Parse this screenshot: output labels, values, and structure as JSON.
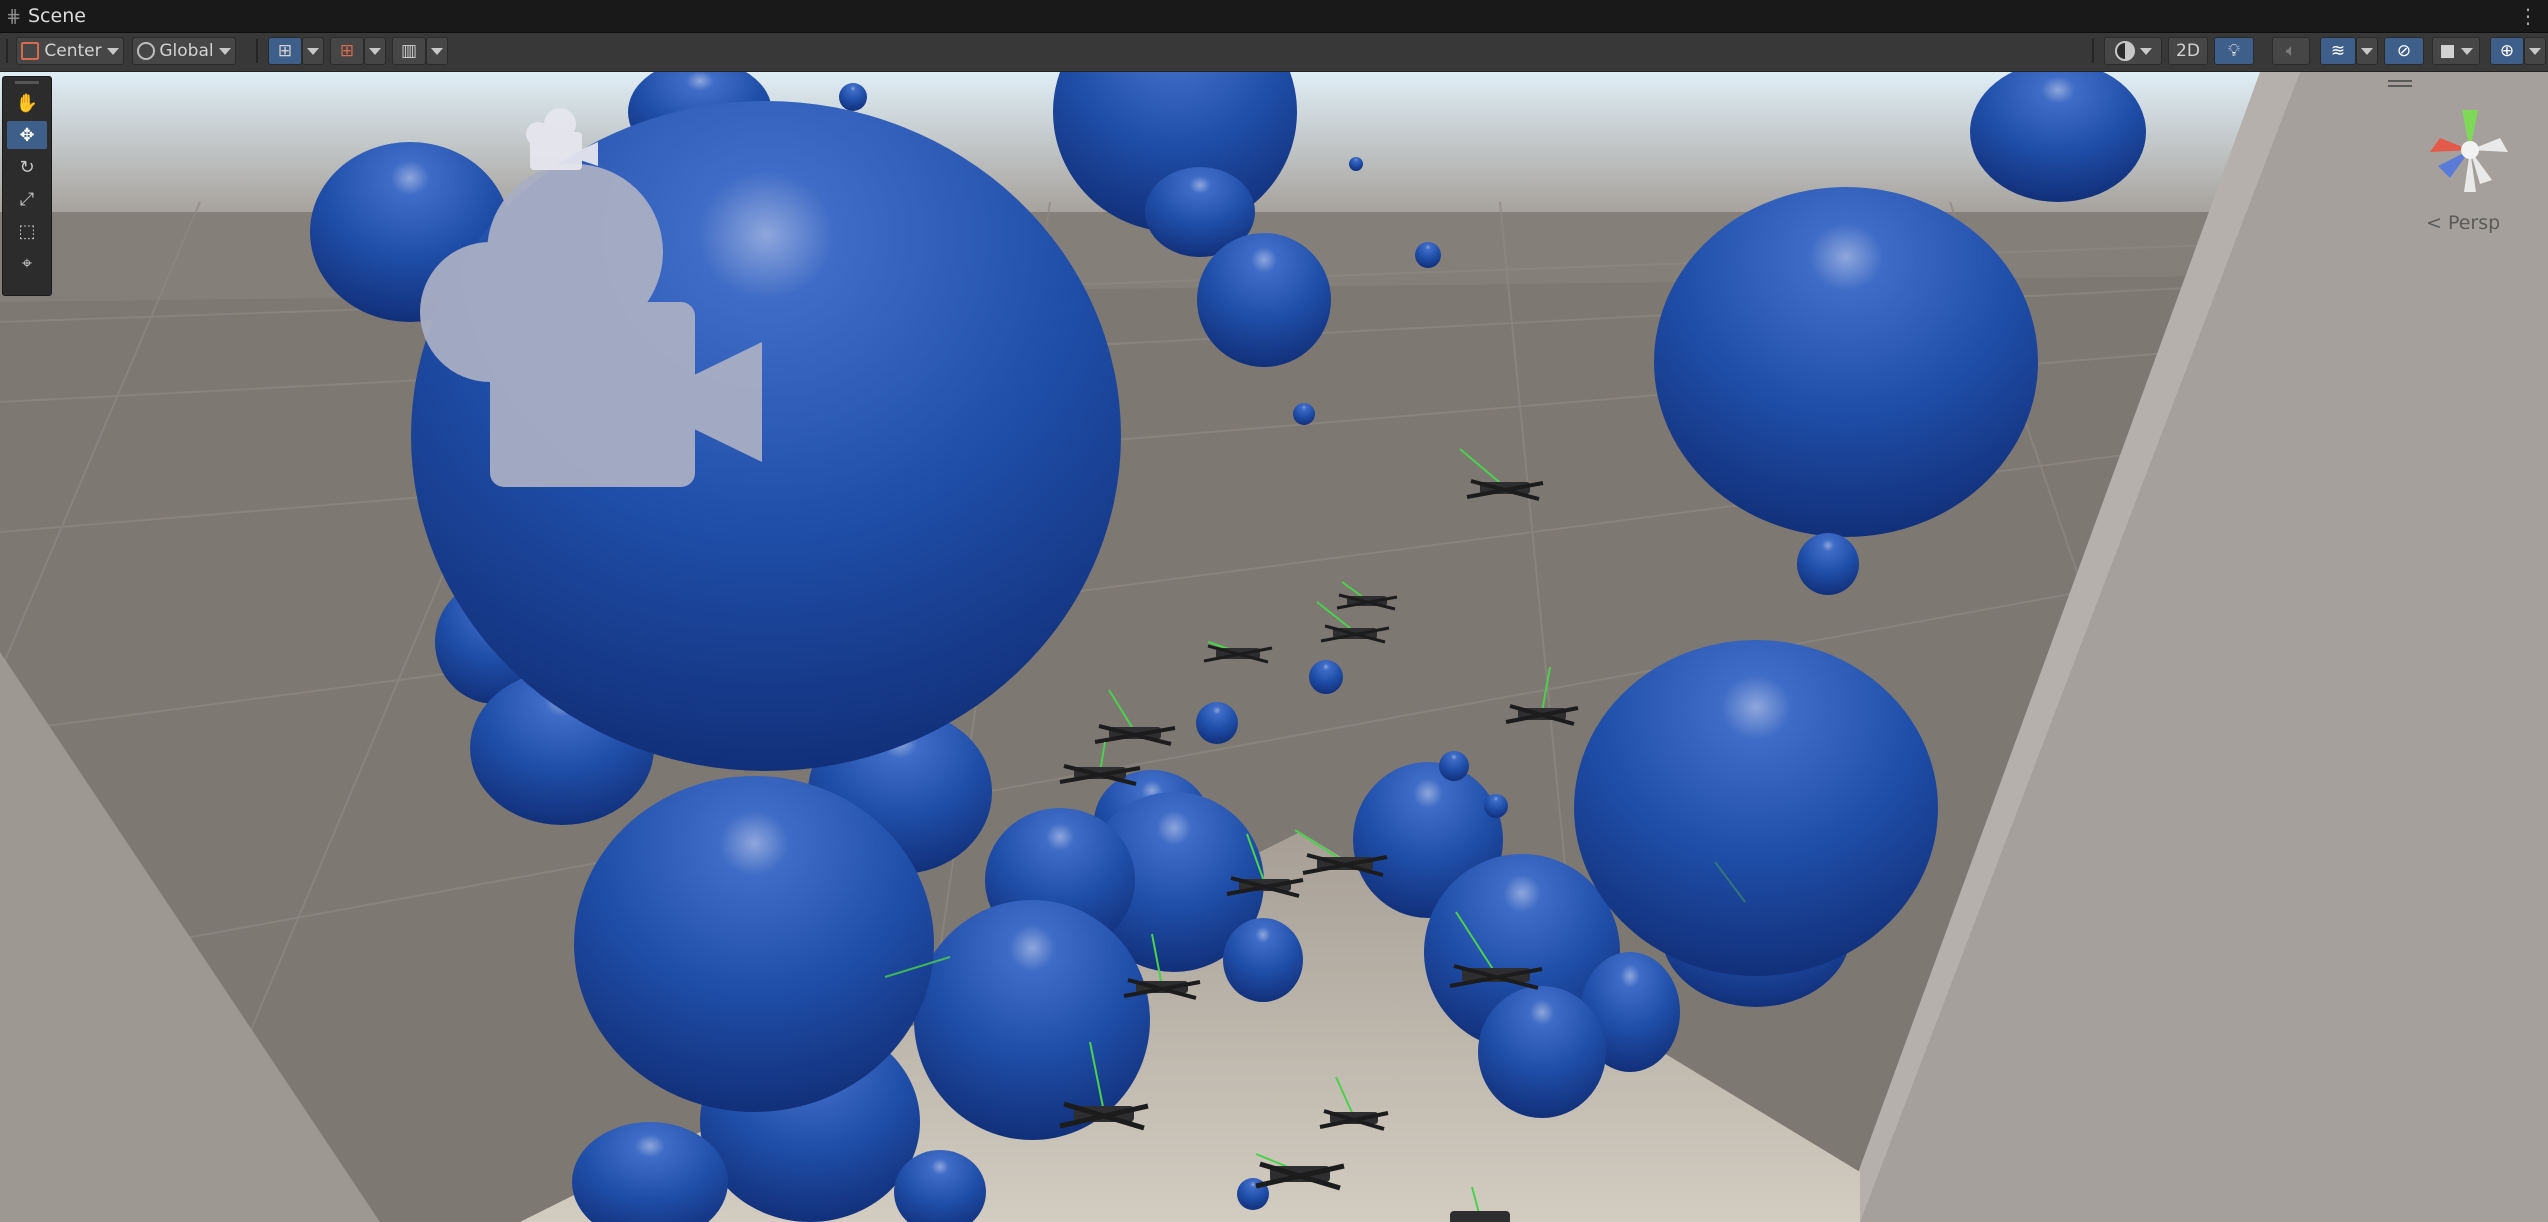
{
  "window": {
    "tab_title": "Scene",
    "menu_icon": "kebab-menu-icon"
  },
  "toolbar": {
    "pivot_mode": "Center",
    "pivot_rotation": "Global",
    "grid_snap_icon": "grid-snap-icon",
    "increment_snap_icon": "increment-snap-icon",
    "ruler_icon": "ruler-icon",
    "draw_mode_icon": "shading-sphere-icon",
    "mode_2d": "2D",
    "lighting_icon": "lightbulb-icon",
    "audio_icon": "speaker-icon",
    "effects_icon": "effects-layers-icon",
    "hidden_icon": "visibility-off-icon",
    "camera_icon": "scene-camera-icon",
    "gizmos_icon": "gizmo-target-icon"
  },
  "tools": [
    {
      "name": "view-hand-tool",
      "icon": "hand-icon",
      "glyph": "✋",
      "active": false
    },
    {
      "name": "move-tool",
      "icon": "move-arrows-icon",
      "glyph": "✥",
      "active": true
    },
    {
      "name": "rotate-tool",
      "icon": "rotate-icon",
      "glyph": "↻",
      "active": false
    },
    {
      "name": "scale-tool",
      "icon": "scale-icon",
      "glyph": "⤢",
      "active": false
    },
    {
      "name": "rect-tool",
      "icon": "rect-transform-icon",
      "glyph": "⬚",
      "active": false
    },
    {
      "name": "transform-tool",
      "icon": "transform-all-icon",
      "glyph": "⌖",
      "active": false
    }
  ],
  "scene_view": {
    "projection_label": "< Persp",
    "sphere_color": "#1f4ea8",
    "ground_color": "#7e7873",
    "floor_color": "#bdb6ab",
    "sky_color": "#cfe1ec"
  }
}
